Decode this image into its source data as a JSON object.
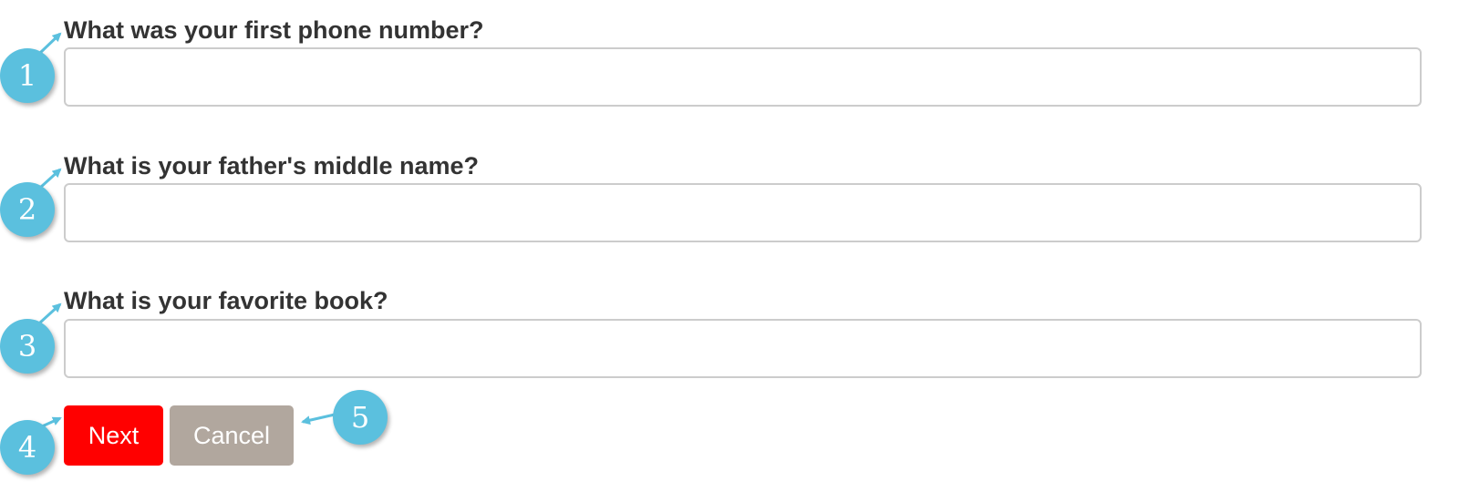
{
  "questions": [
    {
      "label": "What was your first phone number?",
      "value": ""
    },
    {
      "label": "What is your father's middle name?",
      "value": ""
    },
    {
      "label": "What is your favorite book?",
      "value": ""
    }
  ],
  "buttons": {
    "next_label": "Next",
    "cancel_label": "Cancel"
  },
  "callouts": [
    "1",
    "2",
    "3",
    "4",
    "5"
  ],
  "colors": {
    "next_button": "#ff0000",
    "cancel_button": "#b1a79e",
    "callout": "#5bc0de",
    "label_text": "#333333",
    "input_border": "#cccccc"
  }
}
